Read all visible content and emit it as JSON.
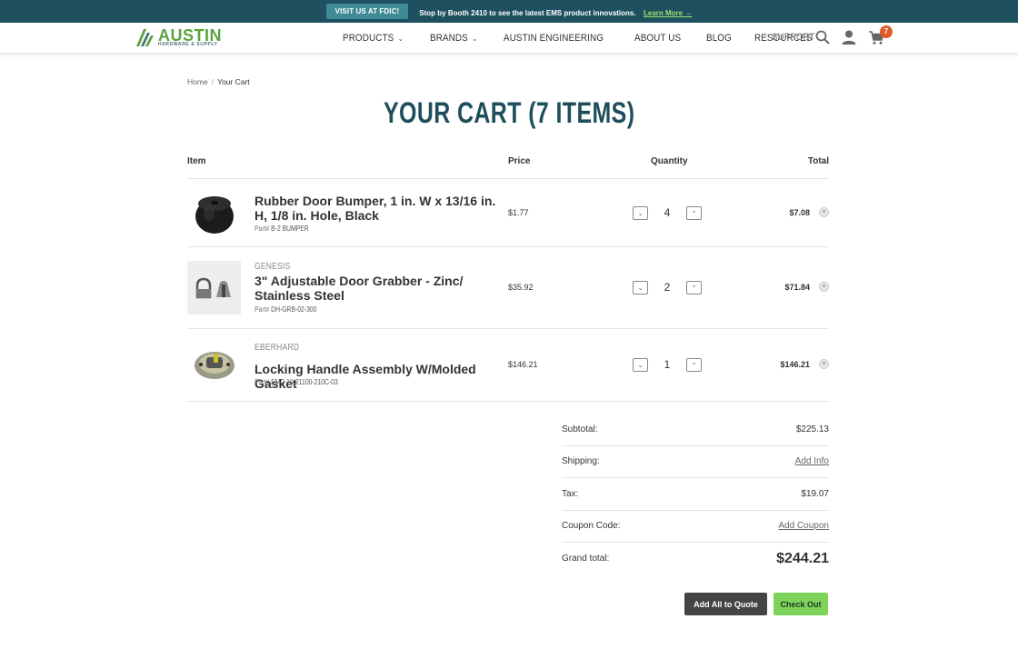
{
  "announcement": {
    "button_label": "VISIT US AT FDIC!",
    "message": "Stop by Booth 2410 to see the latest EMS product innovations.",
    "link_label": "Learn More →"
  },
  "header": {
    "logo_name": "AUSTIN",
    "logo_sub": "HARDWARE & SUPPLY",
    "nav": [
      {
        "label": "PRODUCTS",
        "has_dropdown": true
      },
      {
        "label": "BRANDS",
        "has_dropdown": true
      },
      {
        "label": "AUSTIN ENGINEERING",
        "has_dropdown": false
      },
      {
        "label": "ABOUT US",
        "has_dropdown": false
      },
      {
        "label": "BLOG",
        "has_dropdown": false
      },
      {
        "label": "RESOURCES",
        "has_dropdown": false
      }
    ],
    "support_label": "SUPPORT",
    "icons": [
      "search-icon",
      "account-icon",
      "cart-icon"
    ],
    "cart_count": "7"
  },
  "breadcrumb": {
    "home": "Home",
    "separator": "/",
    "current": "Your Cart"
  },
  "page_title": "YOUR CART (7 ITEMS)",
  "table": {
    "headers": {
      "item": "Item",
      "price": "Price",
      "quantity": "Quantity",
      "total": "Total"
    },
    "rows": [
      {
        "brand": "",
        "name": "Rubber Door Bumper, 1 in. W x 13/16 in. H, 1/8 in. Hole, Black",
        "part_label": "Part#",
        "part_number": "B-2 BUMPER",
        "price": "$1.77",
        "quantity": "4",
        "total": "$7.08"
      },
      {
        "brand": "GENESIS",
        "name": "3\" Adjustable Door Grabber - Zinc/ Stainless Steel",
        "part_label": "Part#",
        "part_number": "DH-GRB-02-300",
        "price": "$35.92",
        "quantity": "2",
        "total": "$71.84"
      },
      {
        "brand": "EBERHARD",
        "name": "Locking Handle Assembly W/Molded Gasket",
        "part_label": "Part#",
        "part_number": "EMC 10-21100-210C-03",
        "price": "$146.21",
        "quantity": "1",
        "total": "$146.21"
      }
    ]
  },
  "summary": {
    "subtotal_label": "Subtotal:",
    "subtotal_value": "$225.13",
    "shipping_label": "Shipping:",
    "shipping_link": "Add Info",
    "tax_label": "Tax:",
    "tax_value": "$19.07",
    "coupon_label": "Coupon Code:",
    "coupon_link": "Add Coupon",
    "grand_label": "Grand total:",
    "grand_value": "$244.21"
  },
  "actions": {
    "quote_label": "Add All to Quote",
    "checkout_label": "Check Out"
  },
  "colors": {
    "brand_dark": "#1e5060",
    "title": "#1e4e5c",
    "accent_green": "#7ed45a",
    "badge": "#e05a2b"
  }
}
